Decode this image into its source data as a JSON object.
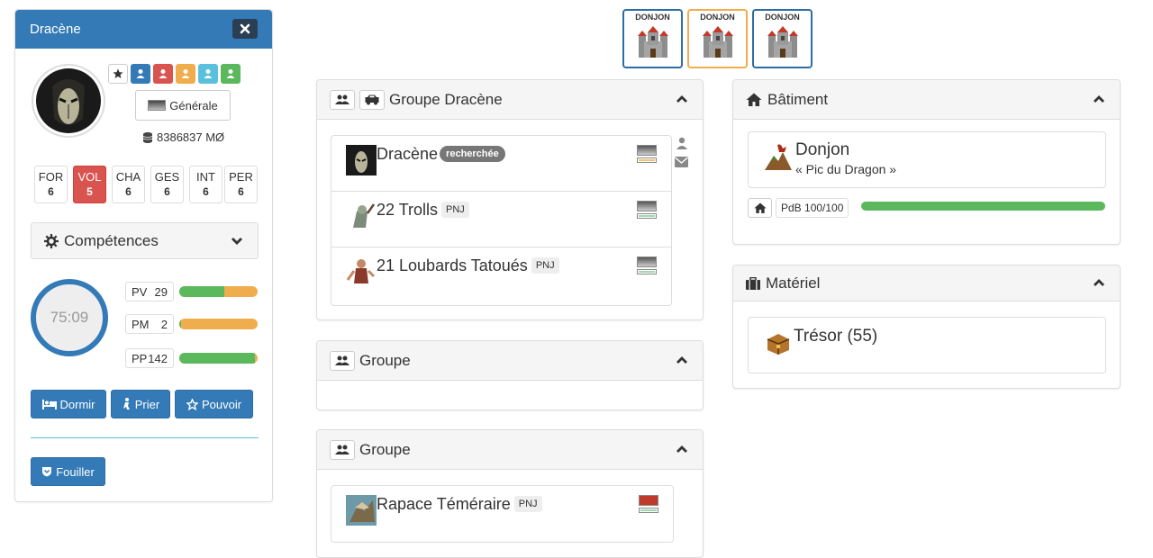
{
  "character": {
    "name": "Dracène",
    "gold": "8386837 MØ",
    "general_label": "Générale",
    "stats": [
      {
        "label": "FOR",
        "value": "6",
        "highlight": false
      },
      {
        "label": "VOL",
        "value": "5",
        "highlight": true
      },
      {
        "label": "CHA",
        "value": "6",
        "highlight": false
      },
      {
        "label": "GES",
        "value": "6",
        "highlight": false
      },
      {
        "label": "INT",
        "value": "6",
        "highlight": false
      },
      {
        "label": "PER",
        "value": "6",
        "highlight": false
      }
    ],
    "skills_label": "Compétences",
    "timer": "75:09",
    "gauges": [
      {
        "label": "PV",
        "value": "29",
        "fill": 0.58
      },
      {
        "label": "PM",
        "value": "2",
        "fill": 0.02
      },
      {
        "label": "PP",
        "value": "142",
        "fill": 0.97
      }
    ],
    "actions": {
      "sleep": "Dormir",
      "pray": "Prier",
      "power": "Pouvoir",
      "search": "Fouiller"
    },
    "group_colors": [
      "#337ab7",
      "#d9534f",
      "#f0ad4e",
      "#5bc0de",
      "#5cb85c"
    ]
  },
  "dungeons": [
    {
      "label": "DONJON",
      "border": "#2e6da4"
    },
    {
      "label": "DONJON",
      "border": "#f0ad4e"
    },
    {
      "label": "DONJON",
      "border": "#2e6da4"
    }
  ],
  "groups": [
    {
      "title": "Groupe Dracène",
      "members": [
        {
          "name": "Dracène",
          "badge": "recherchée",
          "tag": "",
          "bar_color": "#f0c36d",
          "icon": "portrait"
        },
        {
          "name": "22 Trolls",
          "badge": "",
          "tag": "PNJ",
          "bar_color": "#9fd8b0",
          "icon": "troll"
        },
        {
          "name": "21 Loubards Tatoués",
          "badge": "",
          "tag": "PNJ",
          "bar_color": "#9fd8b0",
          "icon": "thug"
        }
      ]
    },
    {
      "title": "Groupe",
      "members": []
    },
    {
      "title": "Groupe",
      "members": [
        {
          "name": "Rapace Téméraire",
          "badge": "",
          "tag": "PNJ",
          "bar_color": "#9fd8b0",
          "icon": "bird"
        }
      ]
    }
  ],
  "building": {
    "title": "Bâtiment",
    "name": "Donjon",
    "subtitle": "« Pic du Dragon »",
    "pdb": "PdB 100/100",
    "pdb_fill": 1.0
  },
  "equipment": {
    "title": "Matériel",
    "item": "Trésor (55)"
  }
}
